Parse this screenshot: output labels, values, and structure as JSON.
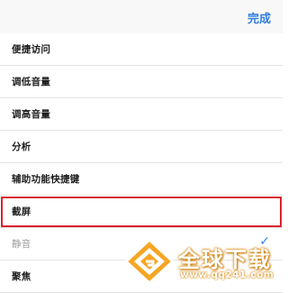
{
  "header": {
    "done_label": "完成"
  },
  "list": {
    "items": [
      {
        "label": "便捷访问"
      },
      {
        "label": "调低音量"
      },
      {
        "label": "调高音量"
      },
      {
        "label": "分析"
      },
      {
        "label": "辅助功能快捷键"
      },
      {
        "label": "截屏",
        "highlighted": true
      },
      {
        "label": "静音",
        "selected": true,
        "check": "✓"
      },
      {
        "label": "聚焦"
      }
    ]
  },
  "watermark": {
    "title": "全球下载",
    "url": "www.qq241.com"
  },
  "colors": {
    "accent": "#2f7de1",
    "highlight_border": "#d9232f",
    "watermark": "#e8951a"
  }
}
